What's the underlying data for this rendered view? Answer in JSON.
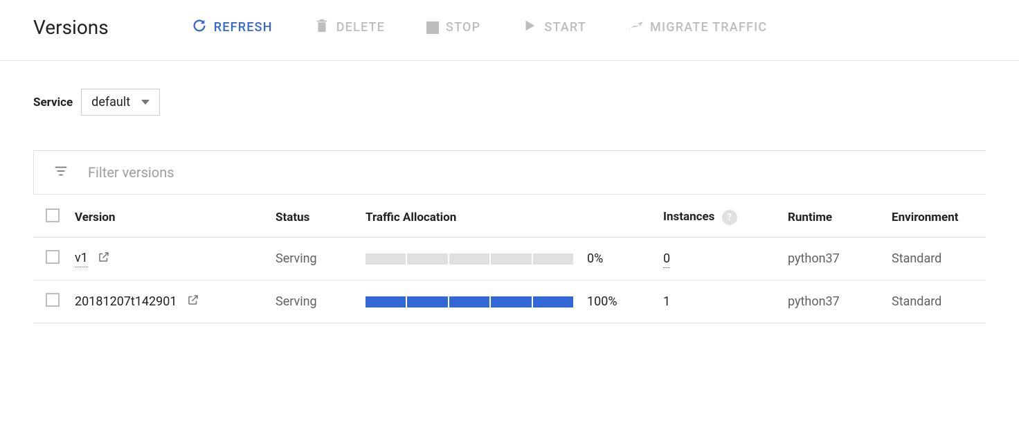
{
  "page": {
    "title": "Versions"
  },
  "toolbar": {
    "refresh": "REFRESH",
    "delete": "DELETE",
    "stop": "STOP",
    "start": "START",
    "migrate": "MIGRATE TRAFFIC"
  },
  "service": {
    "label": "Service",
    "selected": "default"
  },
  "filter": {
    "placeholder": "Filter versions"
  },
  "columns": {
    "version": "Version",
    "status": "Status",
    "traffic": "Traffic Allocation",
    "instances": "Instances",
    "runtime": "Runtime",
    "environment": "Environment"
  },
  "rows": [
    {
      "version": "v1",
      "version_is_link": true,
      "status": "Serving",
      "traffic_pct": "0%",
      "traffic_fill_segments": 0,
      "instances": "0",
      "instances_is_link": true,
      "runtime": "python37",
      "environment": "Standard"
    },
    {
      "version": "20181207t142901",
      "version_is_link": false,
      "status": "Serving",
      "traffic_pct": "100%",
      "traffic_fill_segments": 5,
      "instances": "1",
      "instances_is_link": false,
      "runtime": "python37",
      "environment": "Standard"
    }
  ]
}
